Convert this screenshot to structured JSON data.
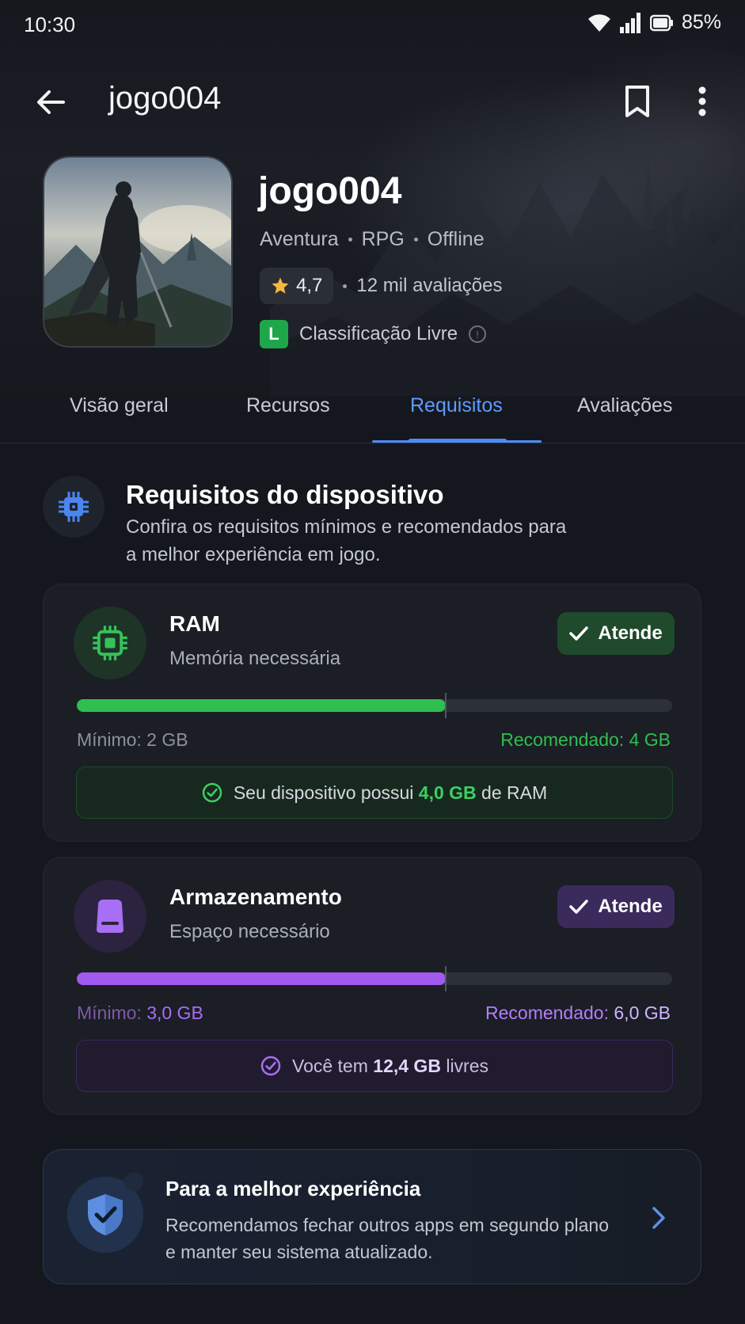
{
  "status_bar": {
    "time": "10:30",
    "battery": "85%"
  },
  "app_bar": {
    "title": "jogo004"
  },
  "game": {
    "name": "jogo004",
    "genres": [
      "Aventura",
      "RPG",
      "Offline"
    ],
    "rating": "4,7",
    "reviews": "12 mil avaliações",
    "age_badge": "L",
    "classification": "Classificação Livre"
  },
  "tabs": [
    {
      "label": "Visão geral",
      "active": false
    },
    {
      "label": "Recursos",
      "active": false
    },
    {
      "label": "Requisitos",
      "active": true
    },
    {
      "label": "Avaliações",
      "active": false
    }
  ],
  "section": {
    "title": "Requisitos do dispositivo",
    "description": "Confira os requisitos mínimos e recomendados para a melhor experiência em jogo."
  },
  "ram": {
    "title": "RAM",
    "subtitle": "Memória necessária",
    "status": "Atende",
    "progress": 0.62,
    "min_label": "Mínimo: 2 GB",
    "rec_label": "Recomendado: 4 GB",
    "note_prefix": "Seu dispositivo possui ",
    "note_value": "4,0 GB",
    "note_suffix": " de RAM",
    "color": "#2fbf4f"
  },
  "storage": {
    "title": "Armazenamento",
    "subtitle": "Espaço necessário",
    "status": "Atende",
    "progress": 0.62,
    "min_prefix": "Mínimo: ",
    "min_value": "3,0 GB",
    "rec_prefix": "Recomendado: ",
    "rec_value": "6,0 GB",
    "note_prefix": "Você tem ",
    "note_value": "12,4 GB",
    "note_suffix": " livres",
    "color": "#a259f0"
  },
  "tip": {
    "title": "Para a melhor experiência",
    "description": "Recomendamos fechar outros apps em segundo plano e manter seu sistema atualizado."
  },
  "icons": {
    "back": "back-arrow-icon",
    "bookmark": "bookmark-icon",
    "more": "more-vert-icon",
    "chip": "chip-icon",
    "storage": "storage-drive-icon",
    "shield": "shield-check-icon",
    "chevron": "chevron-right-icon"
  }
}
